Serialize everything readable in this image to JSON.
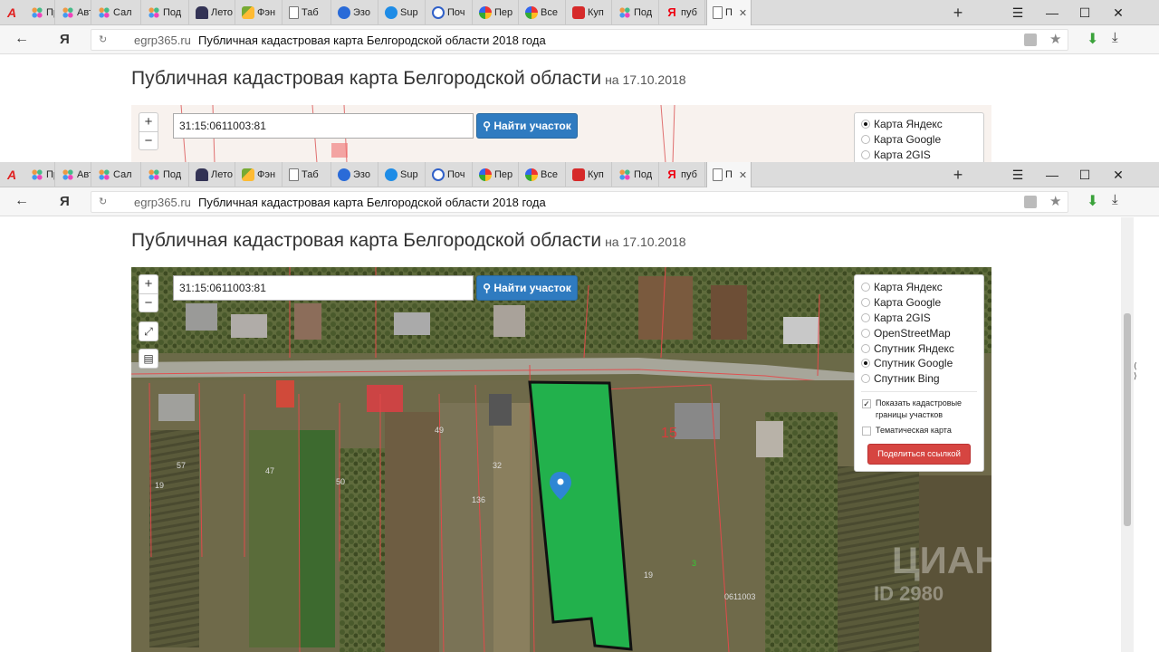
{
  "browser": {
    "tabs": [
      {
        "label": "Про",
        "icon": "dots"
      },
      {
        "label": "Авто",
        "icon": "dots"
      },
      {
        "label": "Сал",
        "icon": "dots"
      },
      {
        "label": "Под",
        "icon": "dots"
      },
      {
        "label": "Лето",
        "icon": "shoe"
      },
      {
        "label": "Фэн",
        "icon": "dash"
      },
      {
        "label": "Таб",
        "icon": "doc"
      },
      {
        "label": "Эзо",
        "icon": "blue"
      },
      {
        "label": "Sup",
        "icon": "cyan"
      },
      {
        "label": "Поч",
        "icon": "mail"
      },
      {
        "label": "Пер",
        "icon": "ring"
      },
      {
        "label": "Все",
        "icon": "ring"
      },
      {
        "label": "Куп",
        "icon": "red"
      },
      {
        "label": "Под",
        "icon": "dots"
      },
      {
        "label": "пуб",
        "icon": "ya"
      },
      {
        "label": "П",
        "icon": "doc",
        "active": true
      }
    ],
    "new_tab": "+",
    "menu": "☰",
    "minimize": "—",
    "maximize": "☐",
    "close": "✕",
    "back": "←",
    "ya_logo": "Я",
    "domain": "egrp365.ru",
    "page_title": "Публичная кадастровая карта Белгородской области 2018 года"
  },
  "page": {
    "heading": "Публичная кадастровая карта Белгородской области",
    "date": "на 17.10.2018"
  },
  "map": {
    "search_value": "31:15:0611003:81",
    "search_button": "Найти участок",
    "zoom_in": "+",
    "zoom_out": "−",
    "layers": [
      {
        "label": "Карта Яндекс"
      },
      {
        "label": "Карта Google"
      },
      {
        "label": "Карта 2GIS"
      },
      {
        "label": "OpenStreetMap"
      },
      {
        "label": "Спутник Яндекс"
      },
      {
        "label": "Спутник Google",
        "selected": true
      },
      {
        "label": "Спутник Bing"
      }
    ],
    "layers_top_selected": "Карта Яндекс",
    "show_borders": "Показать кадастровые границы участков",
    "thematic": "Тематическая карта",
    "share_button": "Поделиться ссылкой",
    "parcel_labels": [
      "15",
      "32",
      "47",
      "57",
      "19",
      "50",
      "49",
      "136",
      "0611003",
      "19",
      "3"
    ],
    "watermark": "ЦИАН",
    "watermark_id": "ID 2980"
  },
  "colors": {
    "accent_blue": "#2f7bc0",
    "share_red": "#d64541",
    "parcel_green": "#22b14c",
    "cadastral_line": "#e04040"
  }
}
